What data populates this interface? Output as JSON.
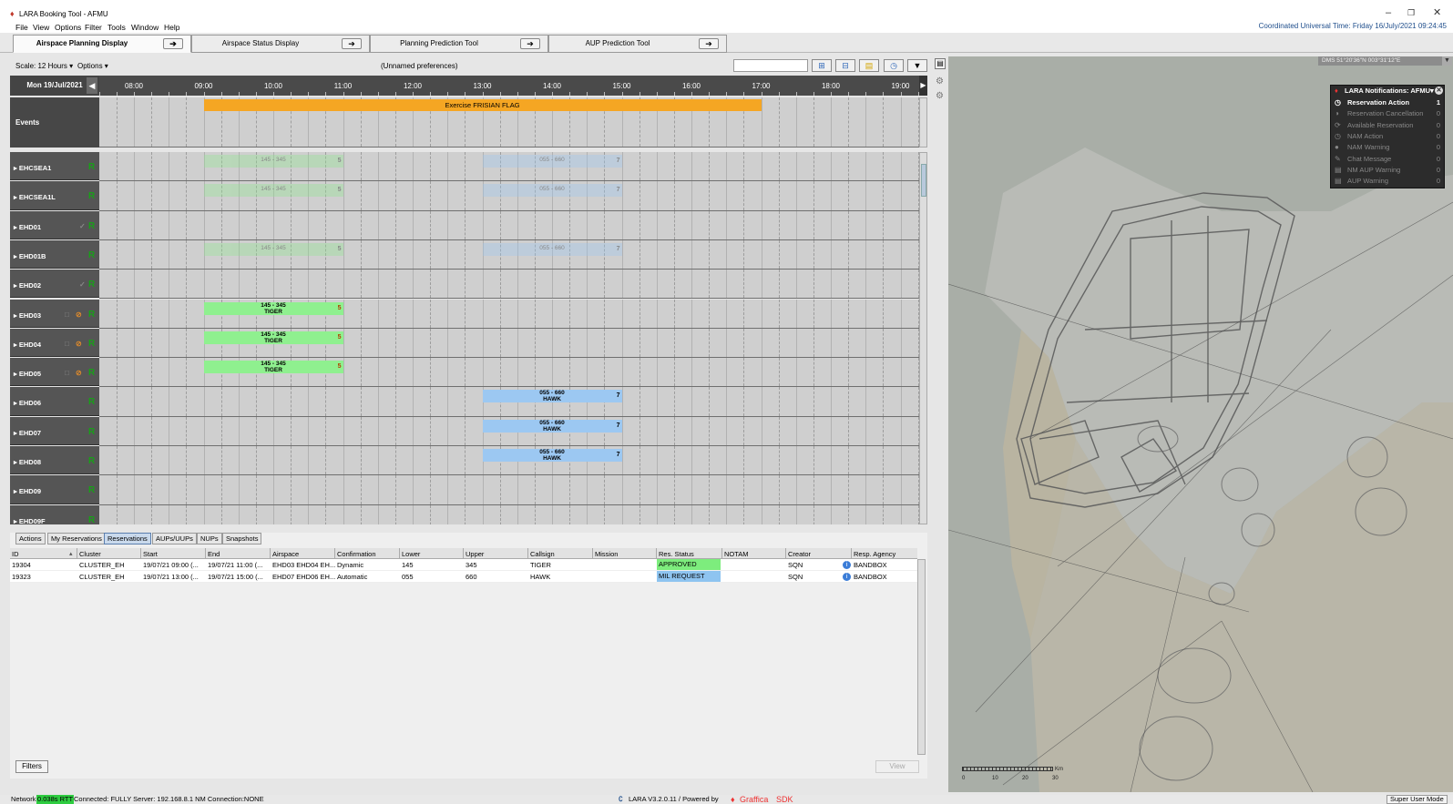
{
  "window": {
    "title": "LARA Booking Tool - AFMU",
    "logo_glyph": "♦",
    "minimize": "–",
    "restore": "❐",
    "close": "✕"
  },
  "menu": [
    "File",
    "View",
    "Options",
    "Filter",
    "Tools",
    "Window",
    "Help"
  ],
  "utc_clock": "Coordinated Universal Time: Friday 16/July/2021   09:24:45",
  "app_tabs": [
    {
      "label": "Airspace Planning Display",
      "active": true
    },
    {
      "label": "Airspace Status Display"
    },
    {
      "label": "Planning Prediction Tool"
    },
    {
      "label": "AUP Prediction Tool"
    }
  ],
  "toolbar": {
    "scale": "Scale: 12 Hours ▾",
    "options": "Options ▾",
    "preferences": "(Unnamed preferences)",
    "search_value": ""
  },
  "planner": {
    "date": "Mon 19/Jul/2021",
    "hours": [
      "08:00",
      "09:00",
      "10:00",
      "11:00",
      "12:00",
      "13:00",
      "14:00",
      "15:00",
      "16:00",
      "17:00",
      "18:00",
      "19:00"
    ],
    "events_label": "Events",
    "event_bar": {
      "label": "Exercise FRISIAN FLAG",
      "start": "09:00",
      "end": "17:00",
      "color": "#f5a623"
    },
    "rows": [
      {
        "name": "EHCSEA1",
        "icons": false,
        "check": false,
        "bookings": [
          {
            "start": "09:00",
            "end": "11:00",
            "levels": "145 - 345",
            "callsign": "",
            "n": "5",
            "color": "#8fe88f",
            "ghost": true
          },
          {
            "start": "13:00",
            "end": "15:00",
            "levels": "055 - 660",
            "callsign": "",
            "n": "7",
            "color": "#9cc8f2",
            "ghost": true
          }
        ]
      },
      {
        "name": "EHCSEA1L",
        "icons": false,
        "check": false,
        "bookings": [
          {
            "start": "09:00",
            "end": "11:00",
            "levels": "145 - 345",
            "callsign": "",
            "n": "5",
            "color": "#8fe88f",
            "ghost": true
          },
          {
            "start": "13:00",
            "end": "15:00",
            "levels": "055 - 660",
            "callsign": "",
            "n": "7",
            "color": "#9cc8f2",
            "ghost": true
          }
        ]
      },
      {
        "name": "EHD01",
        "icons": false,
        "check": true,
        "bookings": []
      },
      {
        "name": "EHD01B",
        "icons": false,
        "check": false,
        "bookings": [
          {
            "start": "09:00",
            "end": "11:00",
            "levels": "145 - 345",
            "callsign": "",
            "n": "5",
            "color": "#8fe88f",
            "ghost": true
          },
          {
            "start": "13:00",
            "end": "15:00",
            "levels": "055 - 660",
            "callsign": "",
            "n": "7",
            "color": "#9cc8f2",
            "ghost": true
          }
        ]
      },
      {
        "name": "EHD02",
        "icons": false,
        "check": true,
        "bookings": []
      },
      {
        "name": "EHD03",
        "icons": true,
        "check": false,
        "bookings": [
          {
            "start": "09:00",
            "end": "11:00",
            "levels": "145 - 345",
            "callsign": "TIGER",
            "n": "5",
            "color": "#8ff08f",
            "ghost": false
          }
        ]
      },
      {
        "name": "EHD04",
        "icons": true,
        "check": false,
        "bookings": [
          {
            "start": "09:00",
            "end": "11:00",
            "levels": "145 - 345",
            "callsign": "TIGER",
            "n": "5",
            "color": "#8ff08f",
            "ghost": false
          }
        ]
      },
      {
        "name": "EHD05",
        "icons": true,
        "check": false,
        "bookings": [
          {
            "start": "09:00",
            "end": "11:00",
            "levels": "145 - 345",
            "callsign": "TIGER",
            "n": "5",
            "color": "#8ff08f",
            "ghost": false
          }
        ]
      },
      {
        "name": "EHD06",
        "icons": false,
        "check": false,
        "bookings": [
          {
            "start": "13:00",
            "end": "15:00",
            "levels": "055 - 660",
            "callsign": "HAWK",
            "n": "7",
            "color": "#9cc8f2",
            "ghost": false
          }
        ]
      },
      {
        "name": "EHD07",
        "icons": false,
        "check": false,
        "bookings": [
          {
            "start": "13:00",
            "end": "15:00",
            "levels": "055 - 660",
            "callsign": "HAWK",
            "n": "7",
            "color": "#9cc8f2",
            "ghost": false
          }
        ]
      },
      {
        "name": "EHD08",
        "icons": false,
        "check": false,
        "bookings": [
          {
            "start": "13:00",
            "end": "15:00",
            "levels": "055 - 660",
            "callsign": "HAWK",
            "n": "7",
            "color": "#9cc8f2",
            "ghost": false
          }
        ]
      },
      {
        "name": "EHD09",
        "icons": false,
        "check": false,
        "bookings": []
      },
      {
        "name": "EHD09F",
        "icons": false,
        "check": false,
        "bookings": []
      }
    ],
    "status_letter": "R"
  },
  "bottom_tabs": [
    {
      "label": "Actions"
    },
    {
      "label": "My Reservations"
    },
    {
      "label": "Reservations",
      "active": true
    },
    {
      "label": "AUPs/UUPs"
    },
    {
      "label": "NUPs"
    },
    {
      "label": "Snapshots"
    }
  ],
  "table": {
    "columns": [
      "ID",
      "Cluster",
      "Start",
      "End",
      "Airspace",
      "Confirmation",
      "Lower",
      "Upper",
      "Callsign",
      "Mission",
      "Res. Status",
      "NOTAM",
      "Creator",
      "Resp. Agency"
    ],
    "rows": [
      [
        "19304",
        "CLUSTER_EH",
        "19/07/21 09:00 (...",
        "19/07/21 11:00 (...",
        "EHD03 EHD04 EH...",
        "Dynamic",
        "145",
        "345",
        "TIGER",
        "",
        "APPROVED",
        "",
        "SQN",
        "BANDBOX"
      ],
      [
        "19323",
        "CLUSTER_EH",
        "19/07/21 13:00 (...",
        "19/07/21 15:00 (...",
        "EHD07 EHD06 EH...",
        "Automatic",
        "055",
        "660",
        "HAWK",
        "",
        "MIL REQUEST",
        "",
        "SQN",
        "BANDBOX"
      ]
    ],
    "status_colors": {
      "APPROVED": "#7ded7d",
      "MIL REQUEST": "#8ec4f0"
    },
    "sort_indicator": "▴"
  },
  "buttons": {
    "filters": "Filters",
    "view": "View"
  },
  "notifications": {
    "title": "LARA Notifications: AFMU▾",
    "items": [
      {
        "label": "Reservation Action",
        "count": "1",
        "active": true,
        "icon": "◷"
      },
      {
        "label": "Reservation Cancellation",
        "count": "0",
        "icon": "◑"
      },
      {
        "label": "Available Reservation",
        "count": "0",
        "icon": "⟳"
      },
      {
        "label": "NAM Action",
        "count": "0",
        "icon": "◷"
      },
      {
        "label": "NAM Warning",
        "count": "0",
        "icon": "●"
      },
      {
        "label": "Chat Message",
        "count": "0",
        "icon": "✎"
      },
      {
        "label": "NM AUP Warning",
        "count": "0",
        "icon": "▤"
      },
      {
        "label": "AUP Warning",
        "count": "0",
        "icon": "▤"
      }
    ]
  },
  "map": {
    "coords": "DMS   51°20'36\"N  003°31'12\"E",
    "scale_labels": [
      "0",
      "10",
      "20",
      "30"
    ],
    "scale_unit": "Km"
  },
  "statusbar": {
    "network": "Network",
    "rtt": "0.038s RTT",
    "connection": "Connected: FULLY Server: 192.168.8.1  NM Connection:NONE",
    "version": "LARA V3.2.0.11  /  Powered by",
    "sdk_brand": "Graffica",
    "sdk": "SDK",
    "mode": "Super User Mode"
  }
}
